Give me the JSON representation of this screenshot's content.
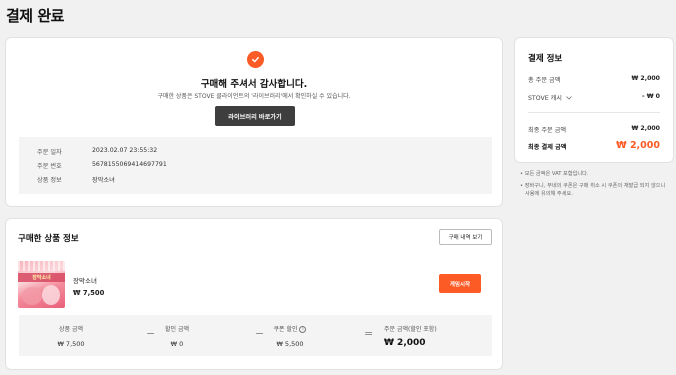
{
  "page": {
    "title": "결제 완료"
  },
  "colors": {
    "accent": "#fc5b25",
    "dark_button": "#3e3e3e"
  },
  "completion": {
    "icon": "check-icon",
    "thanks": "구매해 주셔서 감사합니다.",
    "subtitle": "구매한 상품은 STOVE 클라이언트의 '라이브러리'에서 확인하실 수 있습니다.",
    "library_button": "라이브러리 바로가기",
    "order": [
      {
        "label": "주문 일자",
        "value": "2023.02.07 23:55:32"
      },
      {
        "label": "주문 번호",
        "value": "5678155069414697791"
      },
      {
        "label": "상품 정보",
        "value": "장막소녀"
      }
    ]
  },
  "payment": {
    "title": "결제 정보",
    "rows": [
      {
        "label": "총 주문 금액",
        "value": "₩ 2,000"
      },
      {
        "label": "STOVE 캐시",
        "value": "- ₩ 0"
      },
      {
        "label": "최종 주문 금액",
        "value": "₩ 2,000"
      }
    ],
    "total_label": "최종 결제 금액",
    "total_value": "₩ 2,000",
    "notes": [
      "모든 금액은 VAT 포함입니다.",
      "장바구니, 무네의 쿠폰은 구매 취소 시 쿠폰의 재발급 되지 않으니 사용에 유의해 주세요."
    ]
  },
  "product": {
    "title": "구매한 상품 정보",
    "history_button": "구매 내역 보기",
    "cover_text": "장막소녀",
    "name": "장막소녀",
    "price": "₩ 7,500",
    "start_button": "게임시작",
    "summary": [
      {
        "label": "상품 금액",
        "amount": "₩ 7,500"
      },
      {
        "label": "할인 금액",
        "amount": "₩ 0"
      },
      {
        "label": "쿠폰 할인",
        "amount": "₩ 5,500"
      },
      {
        "label": "주문 금액(할인 포함)",
        "amount": "₩ 2,000"
      }
    ],
    "operators": [
      "−",
      "−",
      "="
    ]
  }
}
